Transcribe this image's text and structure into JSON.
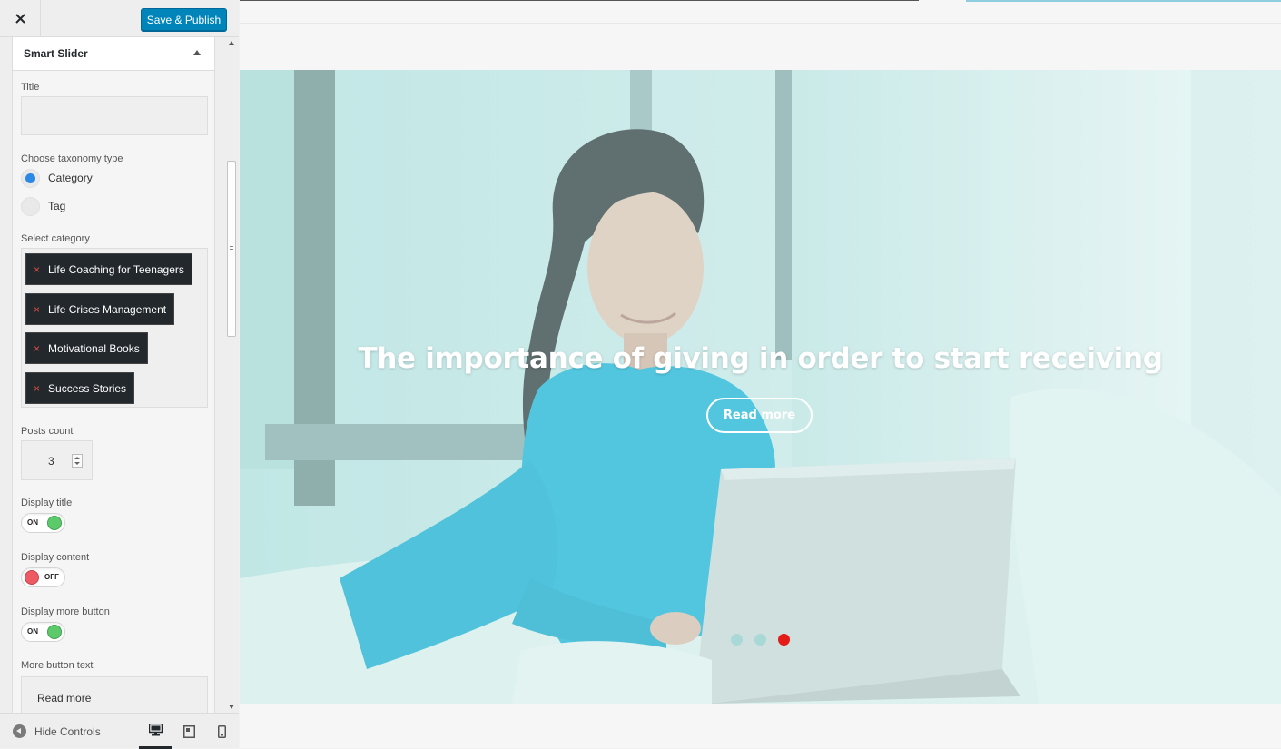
{
  "header": {
    "save_label": "Save & Publish"
  },
  "section": {
    "title": "Smart Slider"
  },
  "controls": {
    "title_label": "Title",
    "title_value": "",
    "taxonomy_label": "Choose taxonomy type",
    "taxonomy_options": [
      {
        "label": "Category",
        "selected": true
      },
      {
        "label": "Tag",
        "selected": false
      }
    ],
    "category_label": "Select category",
    "categories": [
      "Life Coaching for Teenagers",
      "Life Crises Management",
      "Motivational Books",
      "Success Stories"
    ],
    "remove_glyph": "×",
    "posts_count_label": "Posts count",
    "posts_count_value": "3",
    "display_title_label": "Display title",
    "display_title_state": "ON",
    "display_content_label": "Display content",
    "display_content_state": "OFF",
    "display_more_label": "Display more button",
    "display_more_state": "ON",
    "more_text_label": "More button text",
    "more_text_value": "Read more"
  },
  "footer": {
    "hide_controls_label": "Hide Controls",
    "devices": [
      "desktop",
      "tablet",
      "mobile"
    ],
    "active_device": "desktop"
  },
  "preview": {
    "slide_title": "The importance of giving in order to start receiving",
    "read_more_label": "Read more",
    "pager": {
      "count": 3,
      "active_index": 2
    }
  },
  "colors": {
    "primary_button": "#0085ba",
    "toggle_on": "#5cc96b",
    "toggle_off": "#ee5a64",
    "radio_selected": "#2b89e5",
    "pager_active": "#e41b17",
    "pager_inactive": "#a9d9d6",
    "slider_tint": "#bfe5e4"
  },
  "icons": {
    "close": "close-icon",
    "collapse": "chevron-up-icon",
    "hide_controls": "arrow-left-circle-icon",
    "desktop": "desktop-icon",
    "tablet": "tablet-icon",
    "mobile": "mobile-icon"
  }
}
